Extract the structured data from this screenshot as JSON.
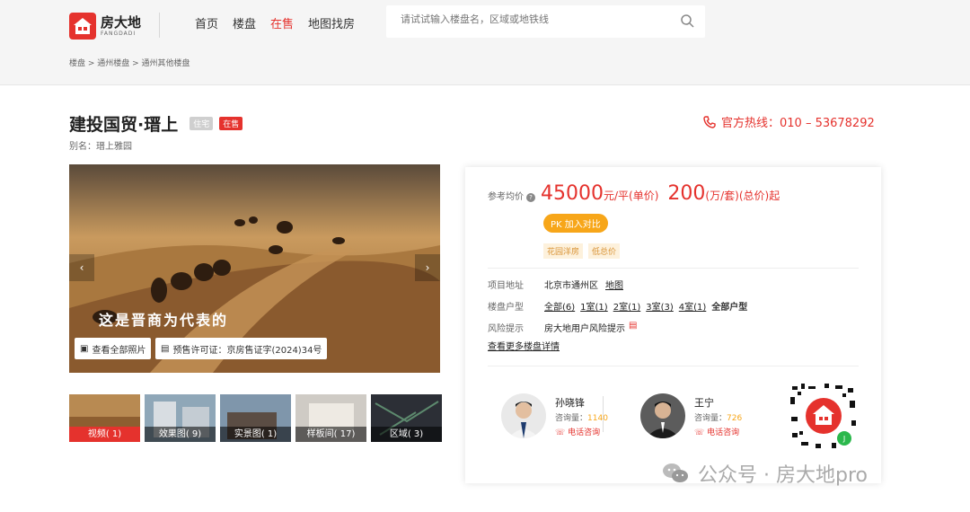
{
  "header": {
    "logo_cn": "房大地",
    "logo_en": "FANGDADI",
    "nav": [
      "首页",
      "楼盘",
      "在售",
      "地图找房"
    ],
    "nav_active": 2,
    "search_placeholder": "请试试输入楼盘名，区域或地铁线"
  },
  "breadcrumb": "楼盘 > 通州楼盘 > 通州其他楼盘",
  "project": {
    "title": "建投国贸·瑨上",
    "tag_type": "住宅",
    "tag_status": "在售",
    "alias": "别名：瑨上雅园"
  },
  "hotline": "官方热线：010 – 53678292",
  "gallery": {
    "overlay_text": "这是晋商为代表的",
    "view_all": "查看全部照片",
    "license": "预售许可证：京房售证字(2024)34号",
    "thumbs": [
      "视频( 1)",
      "效果图( 9)",
      "实景图( 1)",
      "样板间( 17)",
      "区域( 3)"
    ]
  },
  "info": {
    "price_label": "参考均价",
    "unit_price": "45000",
    "unit_price_suffix": "元/平(单价)",
    "total_price": "200",
    "total_price_suffix": "(万/套)(总价)起",
    "compare_btn": "PK 加入对比",
    "feature_tags": [
      "花园洋房",
      "低总价"
    ],
    "address_label": "项目地址",
    "address": "北京市通州区",
    "map_link": "地图",
    "layout_label": "楼盘户型",
    "layouts": [
      "全部(6)",
      "1室(1)",
      "2室(1)",
      "3室(3)",
      "4室(1)"
    ],
    "all_layouts": "全部户型",
    "risk_label": "风险提示",
    "risk_text": "房大地用户风险提示",
    "more_link": "查看更多楼盘详情"
  },
  "agents": [
    {
      "name": "孙晓锋",
      "consult_label": "咨询量：",
      "consult_count": "1140",
      "call": "电话咨询"
    },
    {
      "name": "王宁",
      "consult_label": "咨询量：",
      "consult_count": "726",
      "call": "电话咨询"
    }
  ],
  "watermark": "公众号 · 房大地pro",
  "colors": {
    "accent": "#e5322d",
    "orange": "#f7a619"
  }
}
